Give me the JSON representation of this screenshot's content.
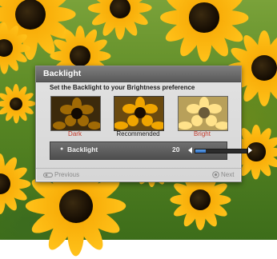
{
  "dialog": {
    "title": "Backlight",
    "instruction": "Set the Backlight to your Brightness preference"
  },
  "previews": [
    {
      "label": "Dark",
      "color": "#c23a2a"
    },
    {
      "label": "Recommended",
      "color": "#222222"
    },
    {
      "label": "Bright",
      "color": "#c23a2a"
    }
  ],
  "control": {
    "label": "Backlight",
    "value": "20",
    "level_fraction": 0.2,
    "left_arrow_icon": "arrow-left-icon",
    "right_arrow_icon": "arrow-right-icon",
    "fill_color": "#3a82d6"
  },
  "navigation": {
    "previous_label": "Previous",
    "next_label": "Next",
    "previous_icon": "remote-control-icon",
    "next_icon": "enter-button-icon"
  }
}
